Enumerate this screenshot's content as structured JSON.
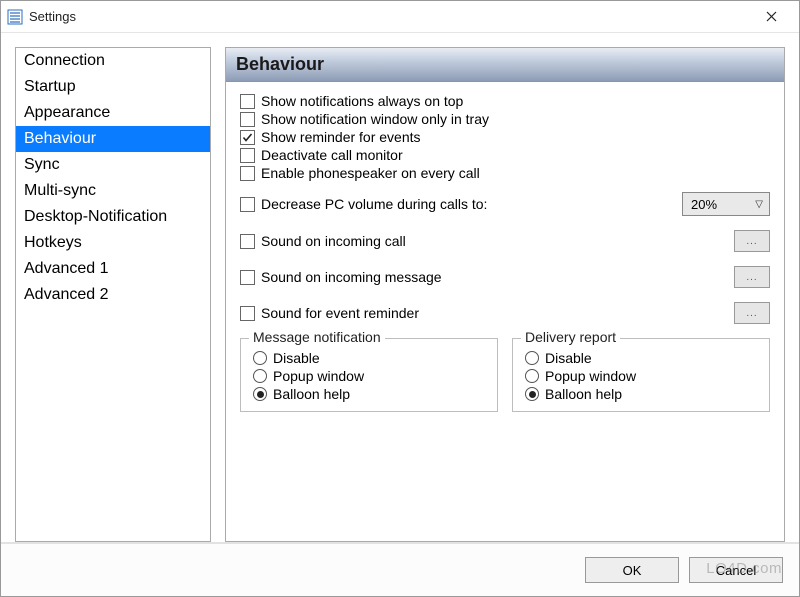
{
  "window": {
    "title": "Settings"
  },
  "sidebar": {
    "items": [
      {
        "label": "Connection"
      },
      {
        "label": "Startup"
      },
      {
        "label": "Appearance"
      },
      {
        "label": "Behaviour"
      },
      {
        "label": "Sync"
      },
      {
        "label": "Multi-sync"
      },
      {
        "label": "Desktop-Notification"
      },
      {
        "label": "Hotkeys"
      },
      {
        "label": "Advanced 1"
      },
      {
        "label": "Advanced 2"
      }
    ],
    "selected_index": 3
  },
  "panel": {
    "title": "Behaviour",
    "checks": [
      {
        "label": "Show notifications always on top",
        "checked": false
      },
      {
        "label": "Show notification window only in tray",
        "checked": false
      },
      {
        "label": "Show reminder for events",
        "checked": true
      },
      {
        "label": "Deactivate call monitor",
        "checked": false
      },
      {
        "label": "Enable phonespeaker on every call",
        "checked": false
      }
    ],
    "volume": {
      "label": "Decrease PC volume during calls to:",
      "checked": false,
      "value": "20%"
    },
    "sounds": [
      {
        "label": "Sound on incoming call",
        "checked": false
      },
      {
        "label": "Sound on incoming message",
        "checked": false
      },
      {
        "label": "Sound for event reminder",
        "checked": false
      }
    ],
    "msg_group": {
      "legend": "Message notification",
      "options": [
        {
          "label": "Disable",
          "checked": false
        },
        {
          "label": "Popup window",
          "checked": false
        },
        {
          "label": "Balloon help",
          "checked": true
        }
      ]
    },
    "delivery_group": {
      "legend": "Delivery report",
      "options": [
        {
          "label": "Disable",
          "checked": false
        },
        {
          "label": "Popup window",
          "checked": false
        },
        {
          "label": "Balloon help",
          "checked": true
        }
      ]
    }
  },
  "footer": {
    "ok": "OK",
    "cancel": "Cancel"
  },
  "watermark": "LO4D.com"
}
